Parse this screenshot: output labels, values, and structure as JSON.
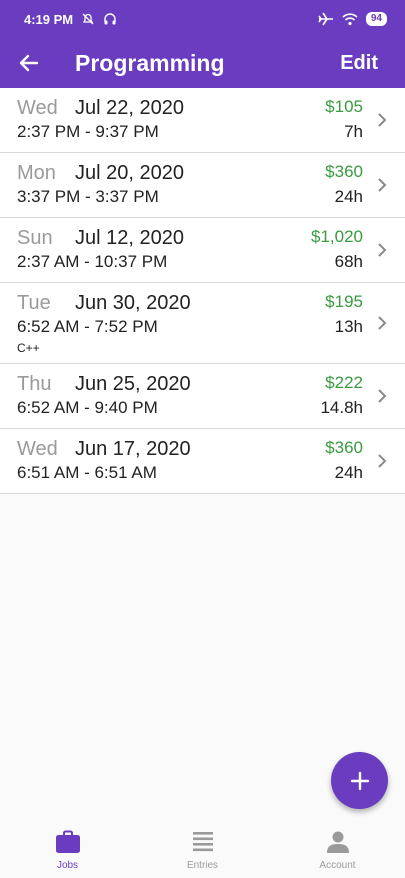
{
  "status_bar": {
    "time": "4:19 PM",
    "battery": "94"
  },
  "app_bar": {
    "title": "Programming",
    "edit_label": "Edit"
  },
  "entries": [
    {
      "dow": "Wed",
      "date": "Jul 22, 2020",
      "time_range": "2:37 PM - 9:37 PM",
      "amount": "$105",
      "hours": "7h",
      "note": ""
    },
    {
      "dow": "Mon",
      "date": "Jul 20, 2020",
      "time_range": "3:37 PM - 3:37 PM",
      "amount": "$360",
      "hours": "24h",
      "note": ""
    },
    {
      "dow": "Sun",
      "date": "Jul 12, 2020",
      "time_range": "2:37 AM - 10:37 PM",
      "amount": "$1,020",
      "hours": "68h",
      "note": ""
    },
    {
      "dow": "Tue",
      "date": "Jun 30, 2020",
      "time_range": "6:52 AM - 7:52 PM",
      "amount": "$195",
      "hours": "13h",
      "note": "C++"
    },
    {
      "dow": "Thu",
      "date": "Jun 25, 2020",
      "time_range": "6:52 AM - 9:40 PM",
      "amount": "$222",
      "hours": "14.8h",
      "note": ""
    },
    {
      "dow": "Wed",
      "date": "Jun 17, 2020",
      "time_range": "6:51 AM - 6:51 AM",
      "amount": "$360",
      "hours": "24h",
      "note": ""
    }
  ],
  "bottom_nav": {
    "jobs": "Jobs",
    "entries": "Entries",
    "account": "Account"
  },
  "colors": {
    "primary": "#6a3cc0",
    "amount": "#3a9a40"
  }
}
